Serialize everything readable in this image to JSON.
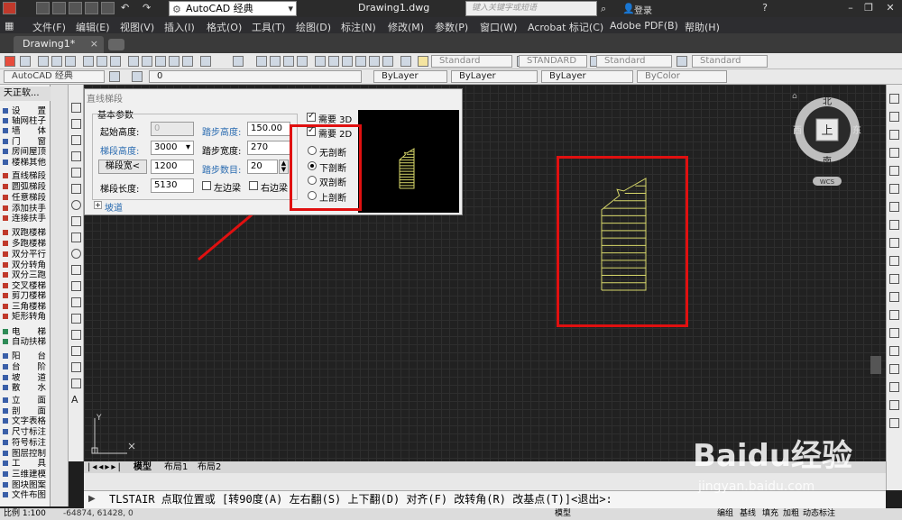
{
  "titlebar": {
    "workspace": "AutoCAD 经典",
    "doc_title": "Drawing1.dwg",
    "search_placeholder": "键入关键字或短语",
    "login": "登录"
  },
  "menu": [
    "文件(F)",
    "编辑(E)",
    "视图(V)",
    "插入(I)",
    "格式(O)",
    "工具(T)",
    "绘图(D)",
    "标注(N)",
    "修改(M)",
    "参数(P)",
    "窗口(W)",
    "Acrobat 标记(C)",
    "Adobe PDF(B)",
    "帮助(H)"
  ],
  "doc_tab": "Drawing1*",
  "toolbar2": {
    "workspace": "AutoCAD 经典",
    "layer": "0",
    "color": "ByLayer",
    "linetype": "ByLayer",
    "lineweight": "ByLayer",
    "plotstyle": "ByColor"
  },
  "styles": {
    "text": "Standard",
    "dim": "STANDARD",
    "table": "Standard",
    "mleader": "Standard"
  },
  "palette": {
    "title": "天正软...",
    "items": [
      "设　　置",
      "轴网柱子",
      "墙　　体",
      "门　　窗",
      "房间屋顶",
      "楼梯其他",
      "直线梯段",
      "圆弧梯段",
      "任意梯段",
      "添加扶手",
      "连接扶手",
      "双跑楼梯",
      "多跑楼梯",
      "双分平行",
      "双分转角",
      "双分三跑",
      "交叉楼梯",
      "剪刀楼梯",
      "三角楼梯",
      "矩形转角",
      "电　　梯",
      "自动扶梯",
      "阳　　台",
      "台　　阶",
      "坡　　道",
      "散　　水",
      "立　　面",
      "剖　　面",
      "文字表格",
      "尺寸标注",
      "符号标注",
      "图层控制",
      "工　　具",
      "三维建模",
      "图块图案",
      "文件布图"
    ]
  },
  "dialog": {
    "title": "直线梯段",
    "group": "基本参数",
    "start_height_label": "起始高度:",
    "start_height": "0",
    "step_height_label": "踏步高度:",
    "step_height": "150.00",
    "seg_height_label": "梯段高度:",
    "seg_height": "3000",
    "step_width_label": "踏步宽度:",
    "step_width": "270",
    "seg_width_btn": "梯段宽<",
    "seg_width": "1200",
    "step_count_label": "踏步数目:",
    "step_count": "20",
    "seg_length_label": "梯段长度:",
    "seg_length": "5130",
    "left_beam": "左边梁",
    "right_beam": "右边梁",
    "need_3d": "需要 3D",
    "need_2d": "需要 2D",
    "radios": [
      "无剖断",
      "下剖断",
      "双剖断",
      "上剖断"
    ],
    "selected_radio": 1,
    "ramp": "坡道"
  },
  "viewcube": {
    "north": "北",
    "south": "南",
    "east": "东",
    "west": "西",
    "top": "上",
    "wcs": "WCS"
  },
  "layout_tabs": [
    "模型",
    "布局1",
    "布局2"
  ],
  "command": "TLSTAIR 点取位置或 [转90度(A) 左右翻(S) 上下翻(D) 对齐(F) 改转角(R) 改基点(T)]<退出>:",
  "status": {
    "scale": "比例 1:100",
    "coords": "-64874, 61428, 0",
    "model": "模型",
    "items": [
      "编组",
      "基线",
      "填充",
      "加粗",
      "动态标注"
    ]
  },
  "watermark": {
    "brand": "Baidu经验",
    "url": "jingyan.baidu.com"
  },
  "colors": {
    "stair_lines": "#d8d86a",
    "highlight": "#e01010",
    "arrow": "#e01010"
  }
}
